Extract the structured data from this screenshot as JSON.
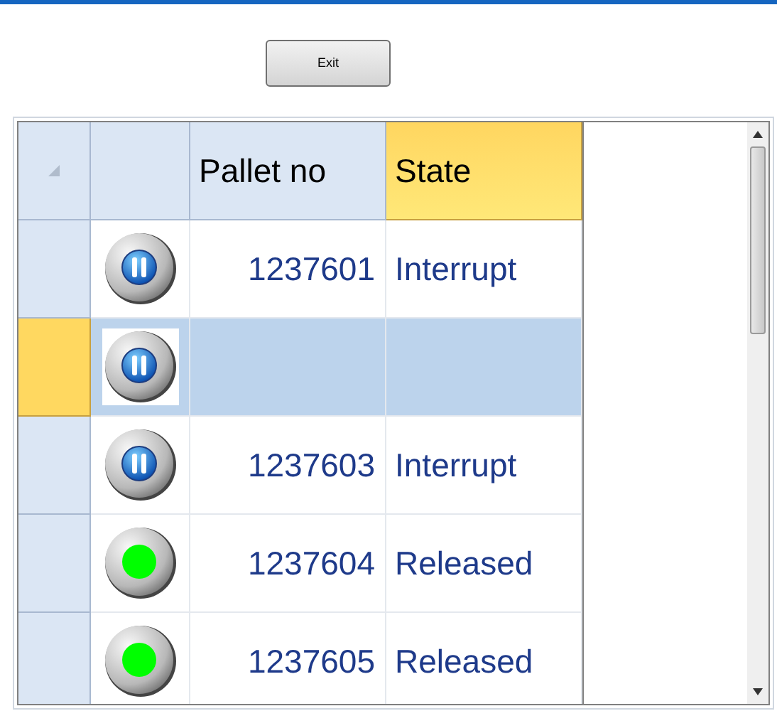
{
  "exit_button": "Exit",
  "table": {
    "columns": [
      {
        "label": "Pallet no",
        "selected": false
      },
      {
        "label": "State",
        "selected": true
      }
    ],
    "rows": [
      {
        "kind": "paused",
        "pallet_no": "1237601",
        "state": "Interrupt",
        "selected": false
      },
      {
        "kind": "paused",
        "selected": true
      },
      {
        "kind": "paused",
        "pallet_no": "1237603",
        "state": "Interrupt",
        "selected": false
      },
      {
        "kind": "released",
        "pallet_no": "1237604",
        "state": "Released",
        "selected": false
      },
      {
        "kind": "released",
        "pallet_no": "1237605",
        "state": "Released",
        "selected": false
      }
    ]
  }
}
